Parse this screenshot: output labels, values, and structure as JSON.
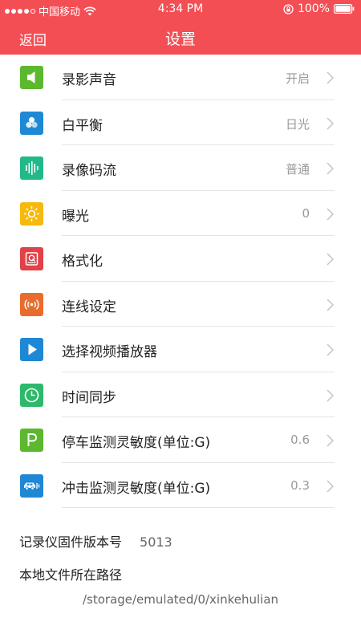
{
  "status_bar": {
    "carrier": "中国移动",
    "time": "4:34 PM",
    "battery": "100%"
  },
  "nav": {
    "back_label": "返回",
    "title": "设置"
  },
  "settings": [
    {
      "label": "录影声音",
      "value": "开启",
      "icon": "speaker-icon",
      "color": "#5cb82e"
    },
    {
      "label": "白平衡",
      "value": "日光",
      "icon": "color-circles-icon",
      "color": "#1f88d5"
    },
    {
      "label": "录像码流",
      "value": "普通",
      "icon": "waveform-icon",
      "color": "#22b98a"
    },
    {
      "label": "曝光",
      "value": "0",
      "icon": "sun-icon",
      "color": "#f6b90d"
    },
    {
      "label": "格式化",
      "value": "",
      "icon": "format-disk-icon",
      "color": "#e14147"
    },
    {
      "label": "连线设定",
      "value": "",
      "icon": "wireless-signal-icon",
      "color": "#ea6c2c"
    },
    {
      "label": "选择视频播放器",
      "value": "",
      "icon": "play-icon",
      "color": "#1f88d5"
    },
    {
      "label": "时间同步",
      "value": "",
      "icon": "clock-icon",
      "color": "#2db96a"
    },
    {
      "label": "停车监测灵敏度(单位:G)",
      "value": "0.6",
      "icon": "parking-icon",
      "color": "#5cb82e"
    },
    {
      "label": "冲击监测灵敏度(单位:G)",
      "value": "0.3",
      "icon": "car-icon",
      "color": "#1f88d5"
    }
  ],
  "info": {
    "firmware_label": "记录仪固件版本号",
    "firmware_value": "5013",
    "path_label": "本地文件所在路径",
    "path_value": "/storage/emulated/0/xinkehulian"
  },
  "colors": {
    "header": "#f44e55",
    "divider": "#e4e4e4",
    "value_text": "#9a9a9a"
  }
}
